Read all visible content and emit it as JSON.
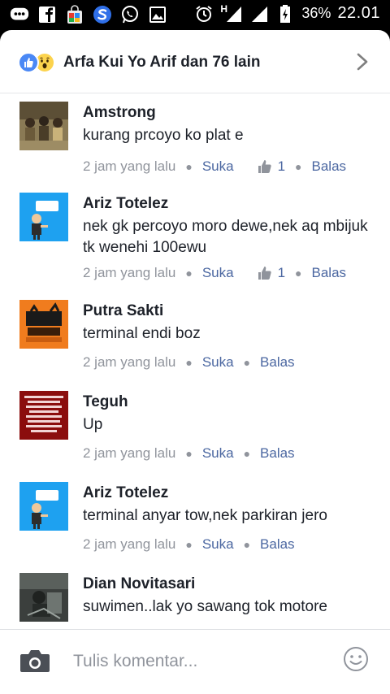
{
  "status_bar": {
    "notification_icons": [
      "chat-bubble-icon",
      "facebook-icon",
      "shopping-bag-icon",
      "s-app-icon",
      "whatsapp-icon",
      "image-icon"
    ],
    "network_label": "H",
    "battery_percent": "36%",
    "time": "22.01"
  },
  "header": {
    "reactions": [
      "like-reaction-icon",
      "wow-reaction-icon"
    ],
    "title": "Arfa Kui Yo Arif dan 76 lain"
  },
  "comments": [
    {
      "name": "Amstrong",
      "text": "kurang prcoyo ko plat e",
      "time": "2 jam yang lalu",
      "like_label": "Suka",
      "like_count": "1",
      "reply_label": "Balas"
    },
    {
      "name": "Ariz Totelez",
      "text": "nek gk percoyo moro dewe,nek aq mbijuk tk wenehi 100ewu",
      "time": "2 jam yang lalu",
      "like_label": "Suka",
      "like_count": "1",
      "reply_label": "Balas"
    },
    {
      "name": "Putra Sakti",
      "text": "terminal endi boz",
      "time": "2 jam yang lalu",
      "like_label": "Suka",
      "like_count": null,
      "reply_label": "Balas"
    },
    {
      "name": "Teguh",
      "text": "Up",
      "time": "2 jam yang lalu",
      "like_label": "Suka",
      "like_count": null,
      "reply_label": "Balas"
    },
    {
      "name": "Ariz Totelez",
      "text": "terminal anyar tow,nek parkiran jero",
      "time": "2 jam yang lalu",
      "like_label": "Suka",
      "like_count": null,
      "reply_label": "Balas"
    },
    {
      "name": "Dian Novitasari",
      "text": "suwimen..lak yo sawang tok motore",
      "time": "",
      "like_label": "",
      "like_count": null,
      "reply_label": ""
    }
  ],
  "composer": {
    "placeholder": "Tulis komentar...",
    "value": ""
  },
  "colors": {
    "link": "#4b67a1",
    "meta_gray": "#90949c",
    "text": "#1d2129",
    "like_blue": "#4a88f5"
  }
}
